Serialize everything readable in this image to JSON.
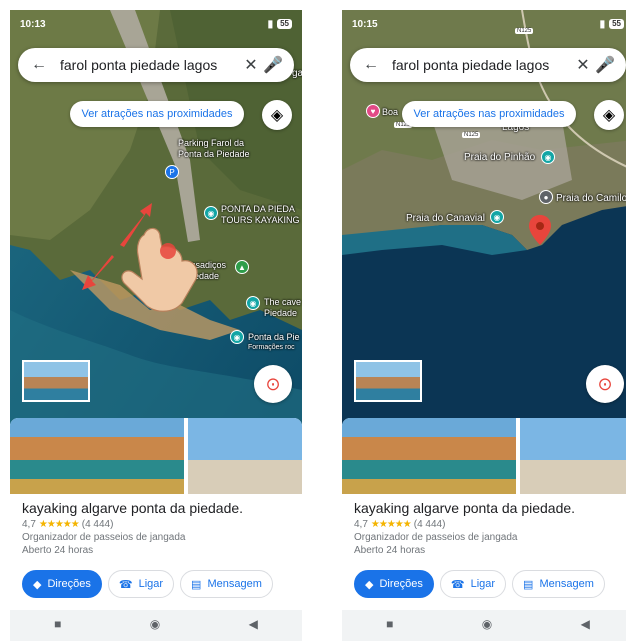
{
  "left": {
    "status_time": "10:13",
    "battery": "55",
    "search_query": "farol ponta piedade lagos",
    "nearby_label": "Ver atrações nas proximidades",
    "map_labels": [
      "Parking Farol da",
      "Ponta da Piedade",
      "PONTA DA PIEDA",
      "TOURS KAYAKING",
      "assadiços",
      "Piedade",
      "The cave",
      "Piedade",
      "Ponta da Pie",
      "Formações roc",
      "gai"
    ],
    "place": {
      "title": "kayaking algarve ponta da piedade.",
      "rating": "4,7",
      "stars": "★★★★★",
      "reviews": "(4 444)",
      "category": "Organizador de passeios de jangada",
      "hours": "Aberto 24 horas"
    },
    "actions": [
      "Direções",
      "Ligar",
      "Mensagem"
    ]
  },
  "right": {
    "status_time": "10:15",
    "battery": "55",
    "search_query": "farol ponta piedade lagos",
    "nearby_label": "Ver atrações nas proximidades",
    "map_labels": [
      "Boa",
      "Lagos",
      "Praia do Pinhão",
      "Praia do Camilo",
      "Praia do Canavial",
      "N125",
      "N125",
      "N125"
    ],
    "place": {
      "title": "kayaking algarve ponta da piedade.",
      "rating": "4,7",
      "stars": "★★★★★",
      "reviews": "(4 444)",
      "category": "Organizador de passeios de jangada",
      "hours": "Aberto 24 horas"
    },
    "actions": [
      "Direções",
      "Ligar",
      "Mensagem"
    ]
  },
  "colors": {
    "accent": "#1a73e8",
    "pin_red": "#e8453c",
    "star": "#f4b400",
    "ocean": "#0b3554"
  },
  "icons": [
    "back-arrow-icon",
    "clear-icon",
    "mic-icon",
    "layers-icon",
    "compass-icon",
    "directions-icon",
    "phone-icon",
    "message-icon",
    "pinch-gesture-icon"
  ]
}
